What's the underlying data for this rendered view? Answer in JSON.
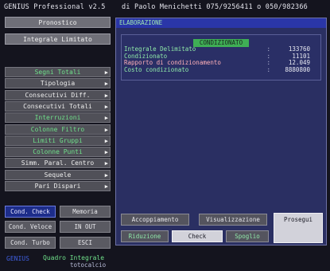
{
  "title": {
    "app": "GENIUS Professional v2.5",
    "author": "di Paolo Menichetti 075/9256411 o 050/982366"
  },
  "left": {
    "top_buttons": [
      "Pronostico",
      "Integrale Limitato"
    ],
    "menu": [
      {
        "label": "Segni Totali",
        "green": true
      },
      {
        "label": "Tipologia",
        "green": false
      },
      {
        "label": "Consecutivi Diff.",
        "green": false
      },
      {
        "label": "Consecutivi Totali",
        "green": false
      },
      {
        "label": "Interruzioni",
        "green": true
      },
      {
        "label": "Colonne Filtro",
        "green": true
      },
      {
        "label": "Limiti Gruppi",
        "green": true
      },
      {
        "label": "Colonne Punti",
        "green": true
      },
      {
        "label": "Simm. Paral. Centro",
        "green": false
      },
      {
        "label": "Sequele",
        "green": false
      },
      {
        "label": "Pari Dispari",
        "green": false
      }
    ],
    "arrow": "▶",
    "small_buttons": [
      {
        "label": "Cond. Check",
        "active": true
      },
      {
        "label": "Memoria",
        "active": false
      },
      {
        "label": "Cond. Veloce",
        "active": false
      },
      {
        "label": "IN   OUT",
        "active": false
      },
      {
        "label": "Cond. Turbo",
        "active": false
      },
      {
        "label": "ESCI",
        "active": false
      }
    ],
    "footer": {
      "brand": "GENIUS",
      "sub": "Quadro Integrale",
      "sub2": "totocalcio"
    }
  },
  "panel": {
    "header": "ELABORAZIONE",
    "result_title": "CONDIZIONATO",
    "rows": [
      {
        "key": "Integrale Delimitato",
        "value": "133760",
        "highlight": false
      },
      {
        "key": "Condizionato",
        "value": "11101",
        "highlight": false
      },
      {
        "key": "Rapporto di condizionamento",
        "value": "12.049",
        "highlight": true
      },
      {
        "key": "Costo condizionato",
        "value": "8880800",
        "highlight": false
      }
    ],
    "separator": ":",
    "actions": {
      "accoppiamento": "Accoppiamento",
      "visualizzazione": "Visualizzazione",
      "prosegui": "Prosegui",
      "riduzione": "Riduzione",
      "check": "Check",
      "spoglio": "Spoglio"
    }
  },
  "colors": {
    "panel_bg": "#2a2f62",
    "header_bg": "#2a36a8",
    "accent_green": "#6fe08a",
    "active_blue": "#1d2d8a"
  }
}
